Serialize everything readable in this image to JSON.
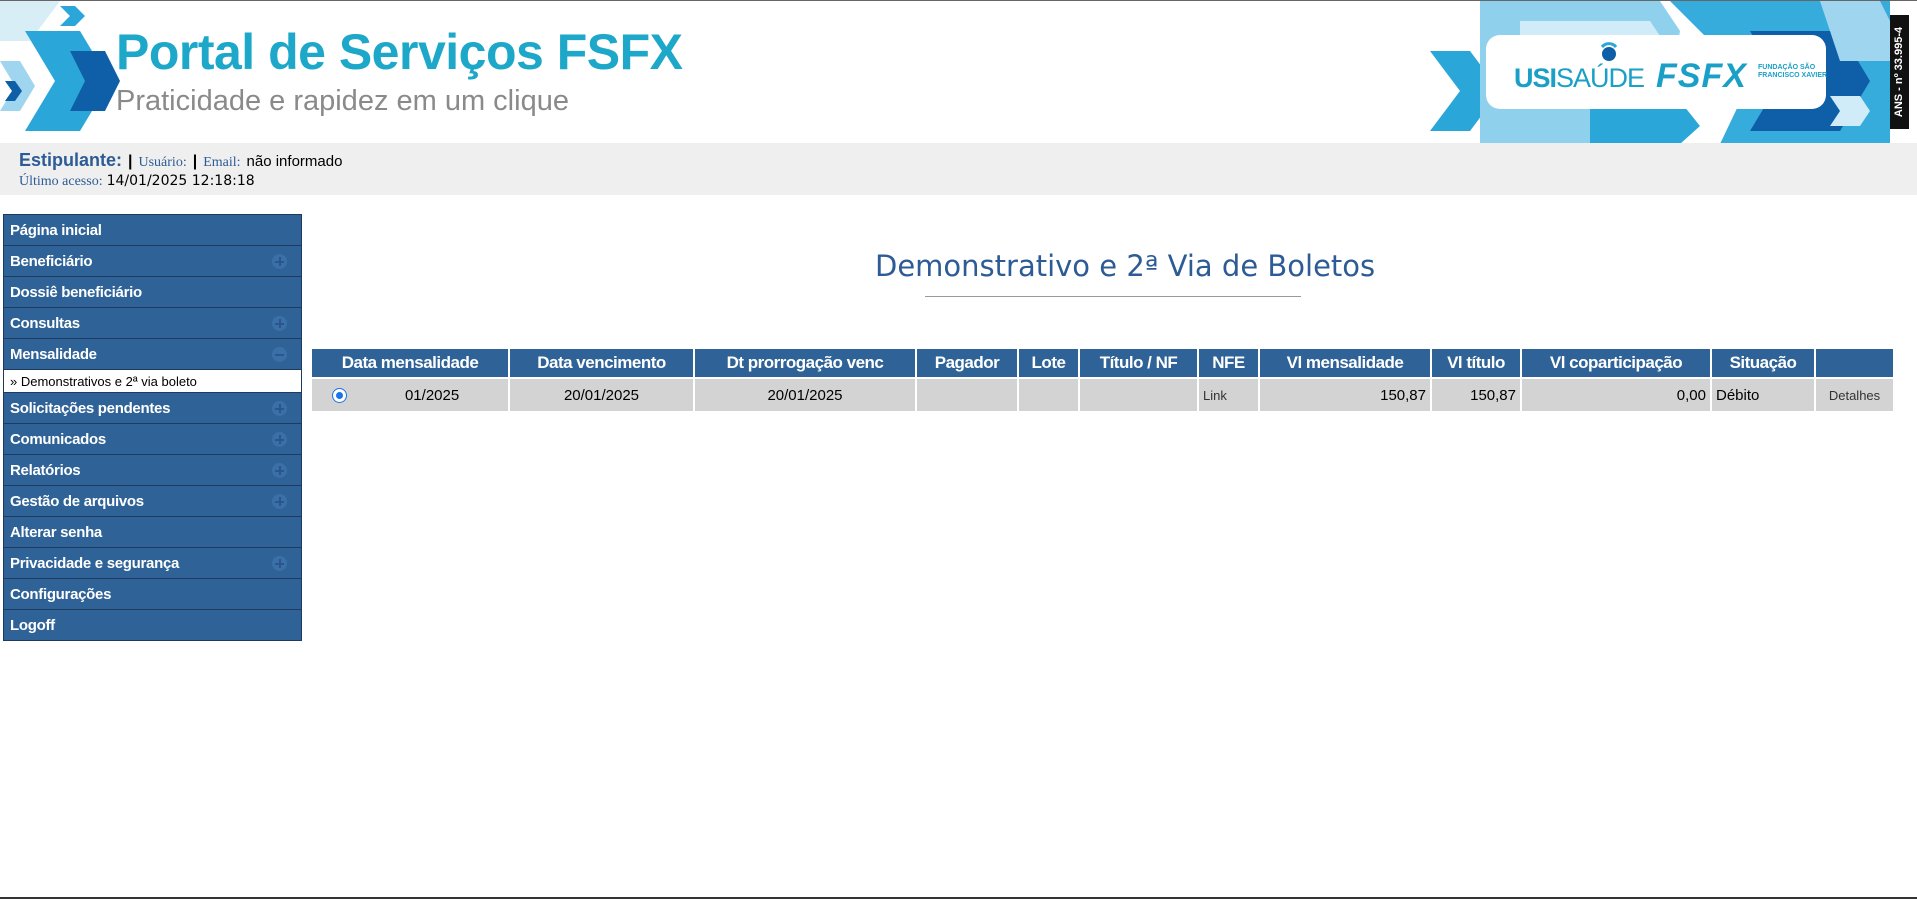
{
  "header": {
    "title": "Portal de Serviços FSFX",
    "subtitle": "Praticidade e rapidez em um clique",
    "logo_usi": "USI",
    "logo_saude": "SAÚDE",
    "logo_fsfx": "FSFX",
    "logo_fsfx_sub": "FUNDAÇÃO SÃO FRANCISCO XAVIER",
    "ans": "ANS - nº 33.995-4",
    "brand_color": "#1da7c9"
  },
  "userbar": {
    "estipulante_label": "Estipulante:",
    "usuario_label": "Usuário:",
    "email_label": "Email:",
    "email_value": "não informado",
    "ultimo_acesso_label": "Último acesso:",
    "ultimo_acesso_value": "14/01/2025 12:18:18"
  },
  "sidebar": {
    "items": [
      {
        "label": "Página inicial",
        "toggle": "none"
      },
      {
        "label": "Beneficiário",
        "toggle": "plus"
      },
      {
        "label": "Dossiê beneficiário",
        "toggle": "none"
      },
      {
        "label": "Consultas",
        "toggle": "plus"
      },
      {
        "label": "Mensalidade",
        "toggle": "minus"
      },
      {
        "label": "Solicitações pendentes",
        "toggle": "plus"
      },
      {
        "label": "Comunicados",
        "toggle": "plus"
      },
      {
        "label": "Relatórios",
        "toggle": "plus"
      },
      {
        "label": "Gestão de arquivos",
        "toggle": "plus"
      },
      {
        "label": "Alterar senha",
        "toggle": "none"
      },
      {
        "label": "Privacidade e segurança",
        "toggle": "plus"
      },
      {
        "label": "Configurações",
        "toggle": "none"
      },
      {
        "label": "Logoff",
        "toggle": "none"
      }
    ],
    "submenu_mensalidade": "» Demonstrativos e 2ª via boleto",
    "menu_color": "#2f6397"
  },
  "main": {
    "title": "Demonstrativo e 2ª Via de Boletos",
    "table": {
      "headers": [
        "Data mensalidade",
        "Data vencimento",
        "Dt prorrogação venc",
        "Pagador",
        "Lote",
        "Título / NF",
        "NFE",
        "Vl mensalidade",
        "Vl título",
        "Vl coparticipação",
        "Situação",
        ""
      ],
      "rows": [
        {
          "selected": true,
          "data_mensalidade": "01/2025",
          "data_vencimento": "20/01/2025",
          "dt_prorrogacao": "20/01/2025",
          "pagador": "",
          "lote": "",
          "titulo_nf": "",
          "nfe": "Link",
          "vl_mensalidade": "150,87",
          "vl_titulo": "150,87",
          "vl_coparticipacao": "0,00",
          "situacao": "Débito",
          "acao": "Detalhes"
        }
      ]
    }
  }
}
